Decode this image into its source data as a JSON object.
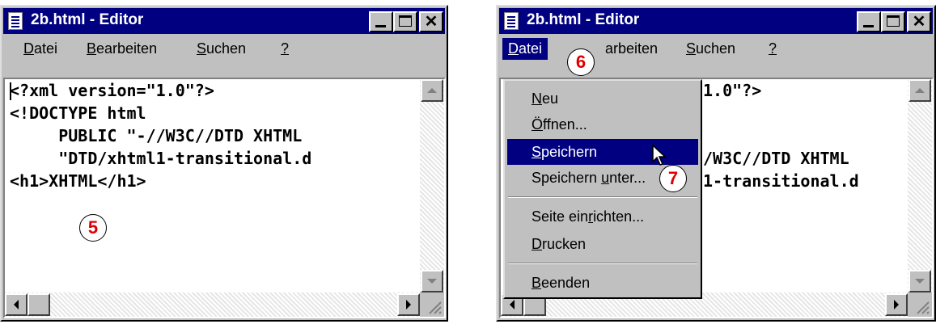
{
  "left_window": {
    "title": "2b.html - Editor",
    "menu": [
      "Datei",
      "Bearbeiten",
      "Suchen",
      "?"
    ],
    "code_lines": [
      "<?xml version=\"1.0\"?>",
      "<!DOCTYPE html",
      "     PUBLIC \"-//W3C//DTD XHTML",
      "     \"DTD/xhtml1-transitional.d",
      "<h1>XHTML</h1>"
    ],
    "badge": "5"
  },
  "right_window": {
    "title": "2b.html - Editor",
    "menu": [
      "Datei",
      "Bearbeiten",
      "Suchen",
      "?"
    ],
    "visible_code_fragments": [
      "1.0\"?>",
      "/W3C//DTD XHTML",
      "1-transitional.d"
    ],
    "menu_cut_label": "arbeiten",
    "dropdown_items": [
      "Neu",
      "Öffnen...",
      "Speichern",
      "Speichern unter...",
      "Seite einrichten...",
      "Drucken",
      "Beenden"
    ],
    "dropdown_highlighted": "Speichern",
    "badge_menu": "6",
    "badge_item": "7"
  },
  "icons": [
    "notepad-icon",
    "minimize-icon",
    "maximize-icon",
    "close-icon",
    "scroll-up-arrow-icon",
    "scroll-down-arrow-icon",
    "scroll-left-arrow-icon",
    "scroll-right-arrow-icon",
    "resize-grip-icon",
    "mouse-pointer-icon"
  ],
  "colors": {
    "titlebar": "#000080",
    "face": "#c0c0c0",
    "badge_text": "#e00000"
  }
}
